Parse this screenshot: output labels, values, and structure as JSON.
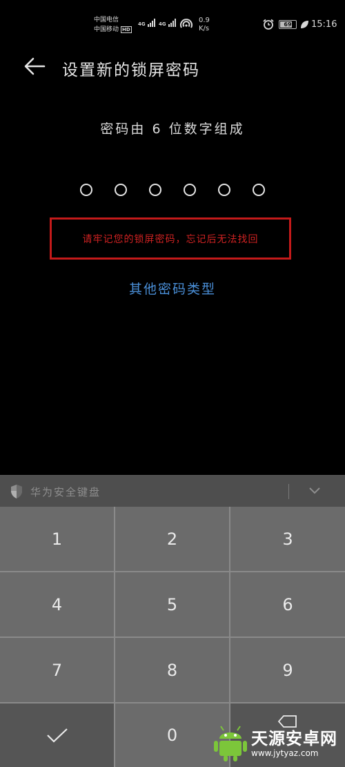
{
  "status_bar": {
    "carrier1": "中国电信",
    "carrier2": "中国移动",
    "hd_label": "HD",
    "net1": "4G",
    "net2": "4G",
    "speed_value": "0.9",
    "speed_unit": "K/s",
    "battery": "69",
    "battery_level": 0.69,
    "time": "15:16",
    "icons": [
      "signal-icon",
      "hotspot-icon",
      "alarm-icon",
      "battery-icon",
      "leaf-icon"
    ]
  },
  "header": {
    "back_icon": "arrow-left-icon",
    "title": "设置新的锁屏密码"
  },
  "main": {
    "subtitle": "密码由 6 位数字组成",
    "pin_length": 6,
    "warning": "请牢记您的锁屏密码，忘记后无法找回",
    "other_types_link": "其他密码类型",
    "colors": {
      "warning": "#d02222",
      "link": "#4a8fd8"
    }
  },
  "keyboard": {
    "title": "华为安全键盘",
    "shield_icon": "shield-icon",
    "collapse_icon": "chevron-down-icon",
    "keys": [
      "1",
      "2",
      "3",
      "4",
      "5",
      "6",
      "7",
      "8",
      "9",
      "",
      "0",
      ""
    ],
    "confirm_icon": "checkmark-icon",
    "delete_icon": "backspace-icon"
  },
  "watermark": {
    "title": "天源安卓网",
    "url": "www.jytyaz.com"
  }
}
